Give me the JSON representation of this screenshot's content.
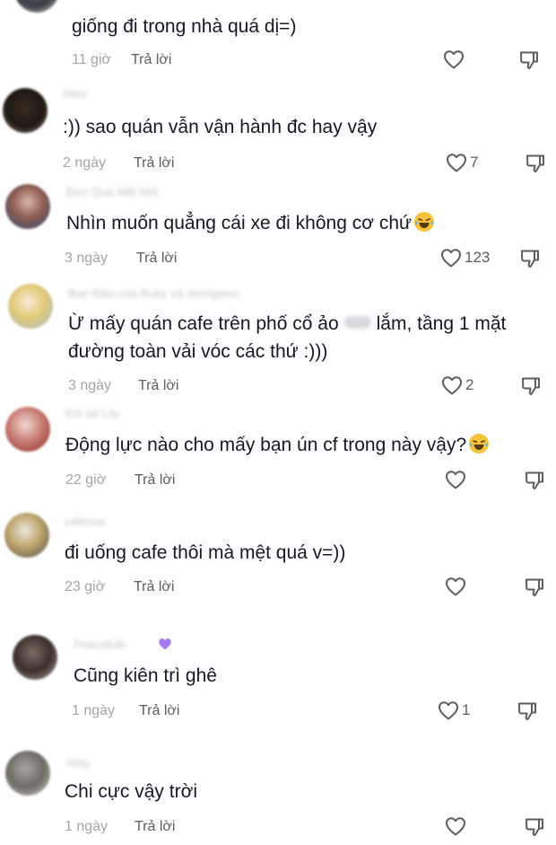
{
  "reply_label": "Trả lời",
  "colors": {
    "text": "#161823",
    "meta": "#a4a4aa",
    "reply": "#5c5c63",
    "icon": "#5c5c63",
    "supporter_badge": "#a77cf0"
  },
  "comments": [
    {
      "avatar": "blurred-avatar",
      "username": "",
      "text": "giống đi trong nhà quá dị=)",
      "time": "11 giờ",
      "likes": ""
    },
    {
      "avatar": "blurred-avatar",
      "username": "Nieu",
      "text": ":)) sao quán vẫn vận hành đc hay vậy",
      "time": "2 ngày",
      "likes": "7"
    },
    {
      "avatar": "blurred-avatar",
      "username": "Đức Quá Mệt Mỏi",
      "text": "Nhìn muốn quẳng cái xe đi không cơ chứ",
      "emoji": "laughing-tears-emoji",
      "time": "3 ngày",
      "likes": "123"
    },
    {
      "avatar": "blurred-avatar",
      "username": "Bạn thân của Ruby và Jeongwoo",
      "text_before": "Ừ mấy quán cafe trên phố cổ ảo",
      "text_after": "lắm, tầng 1 mặt",
      "text_line2": "đường toàn vải vóc các thứ :)))",
      "time": "3 ngày",
      "likes": "2"
    },
    {
      "avatar": "blurred-avatar",
      "username": "Em bé Lily",
      "text": "Động lực nào cho mấy bạn ún cf trong này vậy?",
      "emoji": "laughing-tears-emoji",
      "time": "22 giờ",
      "likes": ""
    },
    {
      "avatar": "blurred-avatar",
      "username": "cafessa",
      "text": "đi uống cafe thôi mà mệt quá v=))",
      "time": "23 giờ",
      "likes": ""
    },
    {
      "avatar": "blurred-avatar",
      "username": "Peacefulb",
      "badge": "purple-heart-icon",
      "text": "Cũng kiên trì ghê",
      "time": "1 ngày",
      "likes": "1"
    },
    {
      "avatar": "blurred-avatar",
      "username": "Holy",
      "text": "Chi cực vậy trời",
      "time": "1 ngày",
      "likes": ""
    }
  ]
}
